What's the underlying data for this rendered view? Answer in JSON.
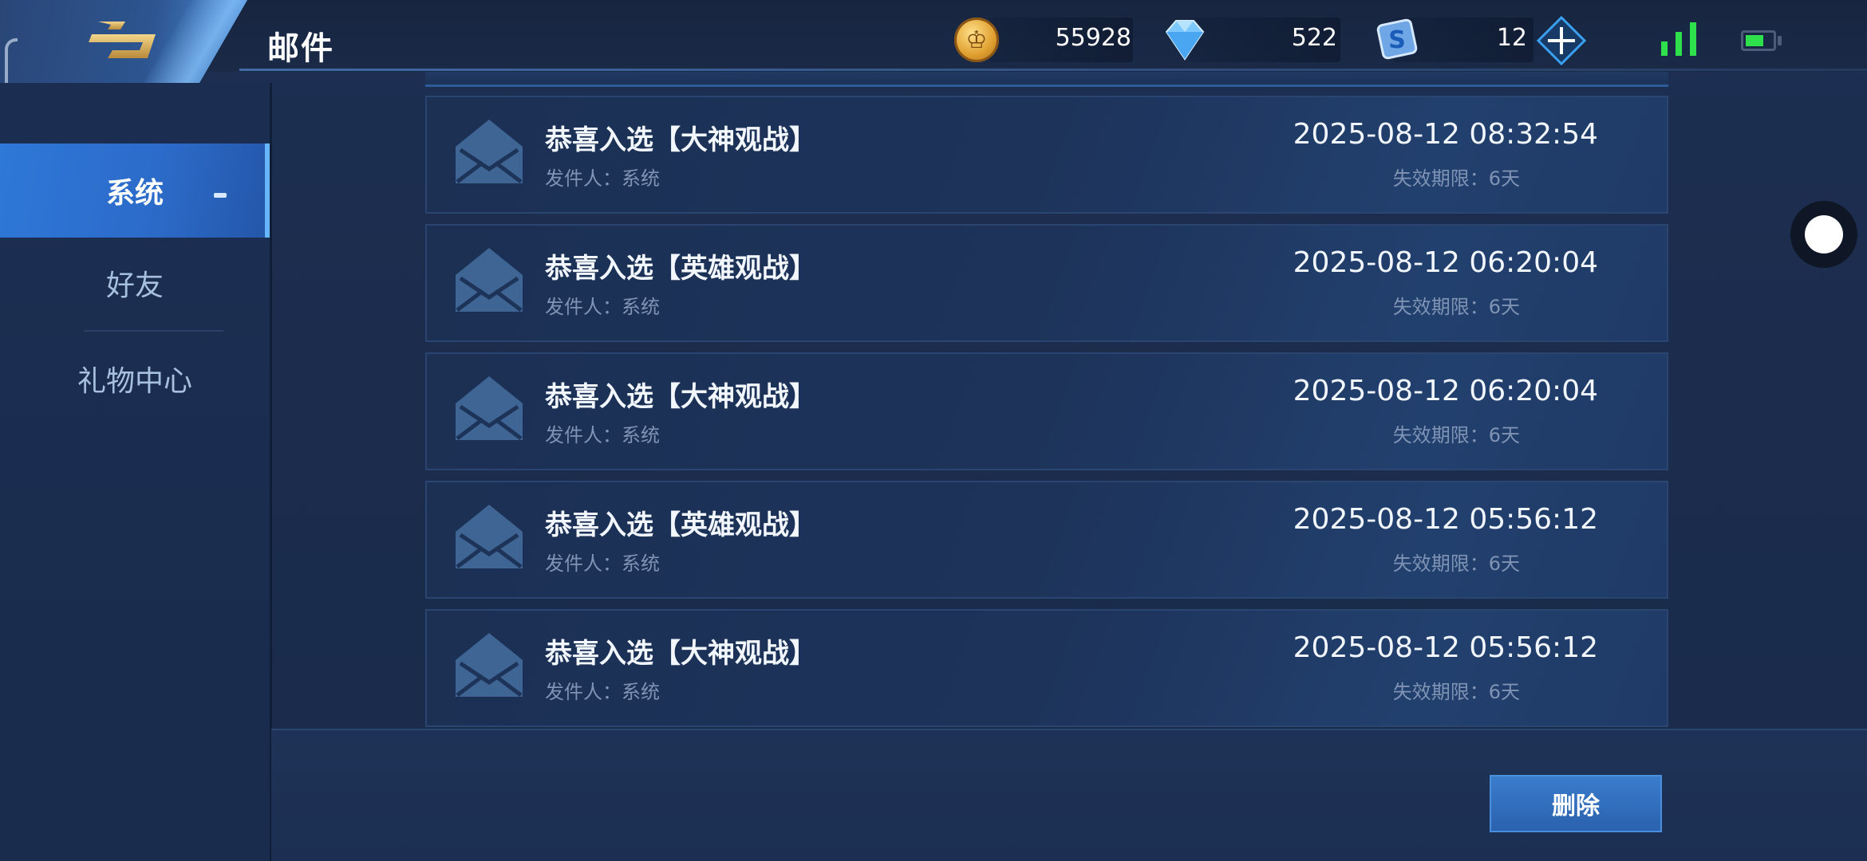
{
  "header": {
    "title": "邮件",
    "gold": "55928",
    "diamond": "522",
    "coupon": "12"
  },
  "sidebar": {
    "items": [
      {
        "label": "系统",
        "active": true
      },
      {
        "label": "好友",
        "active": false
      },
      {
        "label": "礼物中心",
        "active": false
      }
    ]
  },
  "mails": [
    {
      "title": "恭喜入选【大神观战】",
      "sender": "发件人：系统",
      "date": "2025-08-12 08:32:54",
      "expiry": "失效期限：6天"
    },
    {
      "title": "恭喜入选【英雄观战】",
      "sender": "发件人：系统",
      "date": "2025-08-12 06:20:04",
      "expiry": "失效期限：6天"
    },
    {
      "title": "恭喜入选【大神观战】",
      "sender": "发件人：系统",
      "date": "2025-08-12 06:20:04",
      "expiry": "失效期限：6天"
    },
    {
      "title": "恭喜入选【英雄观战】",
      "sender": "发件人：系统",
      "date": "2025-08-12 05:56:12",
      "expiry": "失效期限：6天"
    },
    {
      "title": "恭喜入选【大神观战】",
      "sender": "发件人：系统",
      "date": "2025-08-12 05:56:12",
      "expiry": "失效期限：6天"
    }
  ],
  "footer": {
    "delete_label": "删除"
  },
  "colors": {
    "accent": "#2e78d8",
    "background": "#1a2b4c",
    "battery": "#2ee04b",
    "signal": "#2ee04b"
  }
}
